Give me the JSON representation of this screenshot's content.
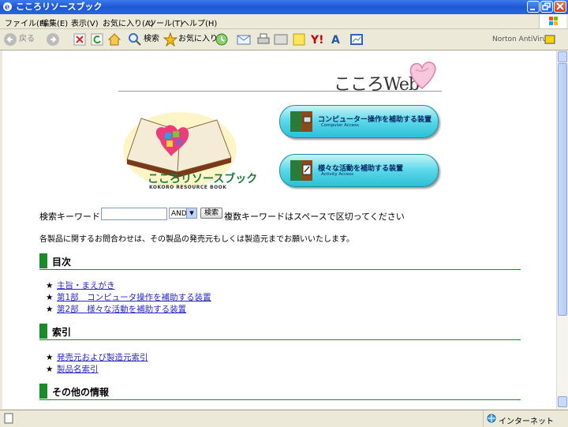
{
  "window": {
    "title": "こころリソースブック"
  },
  "menu": [
    "ファイル(F)",
    "編集(E)",
    "表示(V)",
    "お気に入り(A)",
    "ツール(T)",
    "ヘルプ(H)"
  ],
  "toolbar": {
    "back": "戻る",
    "search": "検索",
    "favorites": "お気に入り",
    "norton": "Norton AntiVirus"
  },
  "header": {
    "site_logo": "こころWeb"
  },
  "book": {
    "title": "こころリソースブック",
    "subtitle": "KOKORO RESOURCE BOOK"
  },
  "buttons": [
    {
      "label": "コンピューター操作を補助する装置",
      "sub": "Computer Access"
    },
    {
      "label": "様々な活動を補助する装置",
      "sub": "Activity Access"
    }
  ],
  "search": {
    "label": "検索キーワード:",
    "value": "",
    "mode": "AND",
    "button": "検索",
    "hint": "複数キーワードはスペースで区切ってください"
  },
  "notice": "各製品に関するお問合わせは、その製品の発売元もしくは製造元までお願いいたします。",
  "sections": [
    {
      "title": "目次",
      "items": [
        "主旨・まえがき",
        "第1部　コンピュータ操作を補助する装置",
        "第2部　様々な活動を補助する装置"
      ]
    },
    {
      "title": "索引",
      "items": [
        "発売元および製造元索引",
        "製品名索引"
      ]
    },
    {
      "title": "その他の情報",
      "items": []
    }
  ],
  "bullet": "★",
  "status": {
    "zone": "インターネット"
  }
}
